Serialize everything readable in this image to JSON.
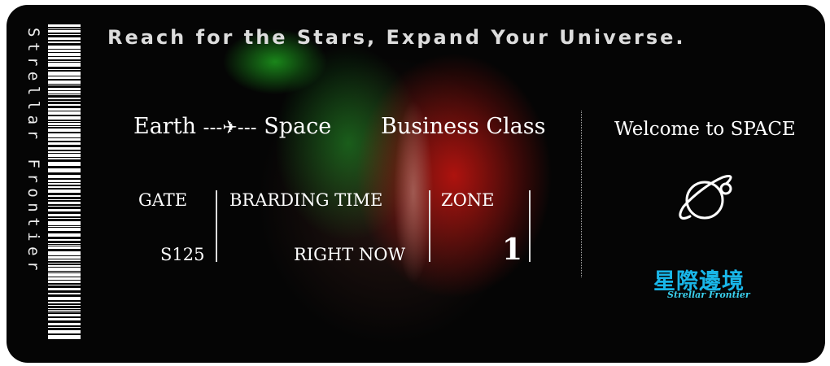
{
  "brand_vertical": "Strellar Frontier",
  "tagline": "Reach for the Stars, Expand Your Universe.",
  "route": {
    "from": "Earth",
    "to": "Space",
    "separator_icon": "airplane-icon"
  },
  "class": "Business Class",
  "fields": [
    {
      "label": "GATE",
      "value": "S125"
    },
    {
      "label": "BRARDING TIME",
      "value": "RIGHT NOW"
    },
    {
      "label": "ZONE",
      "value": "1"
    }
  ],
  "stub": {
    "welcome": "Welcome to SPACE",
    "icon": "planet-icon",
    "logo_cn": "星際邊境",
    "logo_en": "Strellar Frontier"
  }
}
